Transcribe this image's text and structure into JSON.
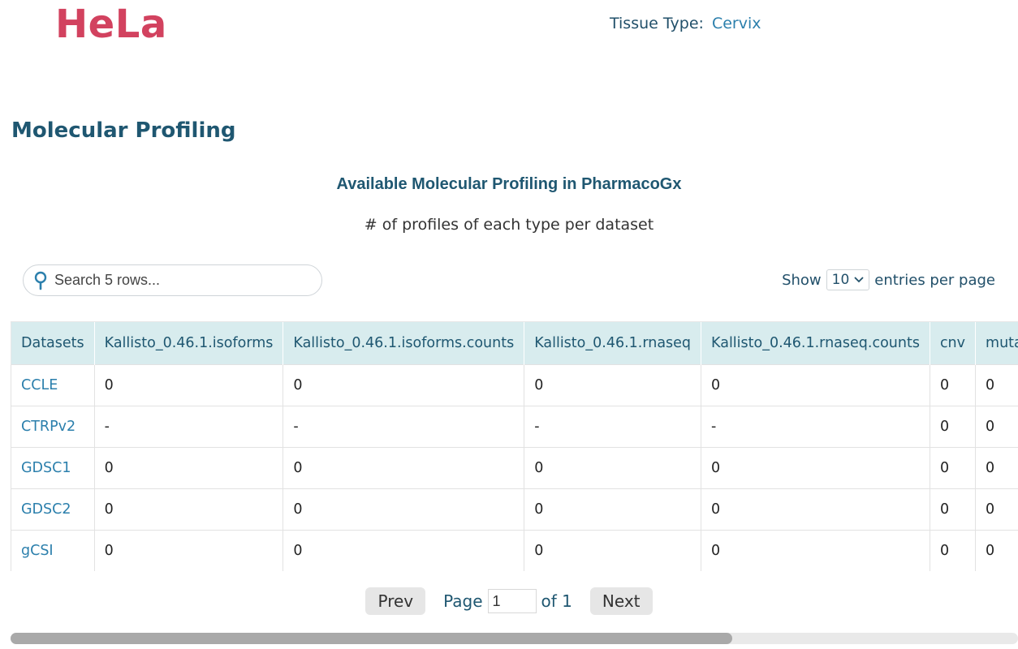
{
  "header": {
    "cell_line": "HeLa",
    "tissue_label": "Tissue Type:",
    "tissue_value": "Cervix"
  },
  "section": {
    "title": "Molecular Profiling"
  },
  "table_block": {
    "title": "Available Molecular Profiling in PharmacoGx",
    "subtitle": "# of profiles of each type per dataset",
    "search_placeholder": "Search 5 rows...",
    "show_label": "Show",
    "entries_value": "10",
    "entries_suffix": "entries per page",
    "columns": [
      "Datasets",
      "Kallisto_0.46.1.isoforms",
      "Kallisto_0.46.1.isoforms.counts",
      "Kallisto_0.46.1.rnaseq",
      "Kallisto_0.46.1.rnaseq.counts",
      "cnv",
      "mutation"
    ],
    "rows": [
      [
        "CCLE",
        "0",
        "0",
        "0",
        "0",
        "0",
        "0"
      ],
      [
        "CTRPv2",
        "-",
        "-",
        "-",
        "-",
        "0",
        "0"
      ],
      [
        "GDSC1",
        "0",
        "0",
        "0",
        "0",
        "0",
        "0"
      ],
      [
        "GDSC2",
        "0",
        "0",
        "0",
        "0",
        "0",
        "0"
      ],
      [
        "gCSI",
        "0",
        "0",
        "0",
        "0",
        "0",
        "0"
      ]
    ]
  },
  "pagination": {
    "prev_label": "Prev",
    "page_label": "Page",
    "page_value": "1",
    "of_label": "of 1",
    "next_label": "Next"
  },
  "colors": {
    "cell_line": "#d2425f",
    "heading": "#1f5771",
    "link": "#2b7fac",
    "header_bg": "#d8ecee"
  },
  "icons": {
    "search": "search-icon",
    "dropdown": "chevron-down-icon"
  }
}
